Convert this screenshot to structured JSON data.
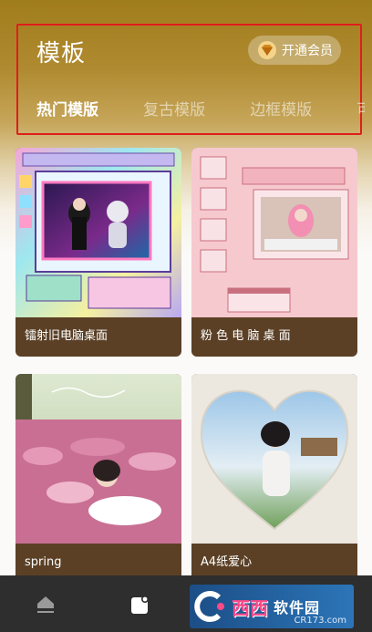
{
  "header": {
    "title": "模板",
    "vip_label": "开通会员",
    "tabs": [
      {
        "label": "热门模版",
        "active": true
      },
      {
        "label": "复古模版",
        "active": false
      },
      {
        "label": "边框模版",
        "active": false
      },
      {
        "label": "可",
        "active": false
      }
    ]
  },
  "templates": [
    {
      "label": "镭射旧电脑桌面"
    },
    {
      "label": "粉 色 电 脑 桌 面"
    },
    {
      "label": "spring"
    },
    {
      "label": "A4纸爱心"
    }
  ],
  "bottom_nav": {
    "items": [
      {
        "icon": "home-icon"
      },
      {
        "icon": "template-icon"
      }
    ]
  },
  "watermark": {
    "brand": "西西",
    "site": "软件园",
    "url": "CR173.com"
  },
  "colors": {
    "header_gold": "#a07d1c",
    "highlight_red": "#e01d1d",
    "card_brown": "#5b4026",
    "bottom_bar": "#2e2e2e"
  }
}
